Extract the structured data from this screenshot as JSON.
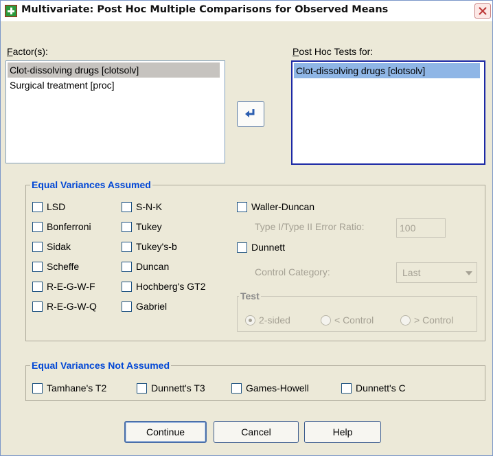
{
  "window": {
    "title": "Multivariate: Post Hoc Multiple Comparisons for Observed Means"
  },
  "factors": {
    "label": "Factor(s):",
    "items": [
      "Clot-dissolving drugs [clotsolv]",
      "Surgical treatment [proc]"
    ]
  },
  "posthoc": {
    "label": "Post Hoc Tests for:",
    "items": [
      "Clot-dissolving drugs [clotsolv]"
    ]
  },
  "move_button": {
    "icon": "arrow-left-icon"
  },
  "equal_variances": {
    "title": "Equal Variances Assumed",
    "col1": [
      "LSD",
      "Bonferroni",
      "Sidak",
      "Scheffe",
      "R-E-G-W-F",
      "R-E-G-W-Q"
    ],
    "col2": [
      "S-N-K",
      "Tukey",
      "Tukey's-b",
      "Duncan",
      "Hochberg's GT2",
      "Gabriel"
    ],
    "waller_duncan": "Waller-Duncan",
    "error_ratio_label": "Type I/Type II Error Ratio:",
    "error_ratio_value": "100",
    "dunnett": "Dunnett",
    "control_category_label": "Control Category:",
    "control_category_value": "Last",
    "test": {
      "title": "Test",
      "options": [
        "2-sided",
        "< Control",
        "> Control"
      ],
      "selected": "2-sided"
    }
  },
  "unequal_variances": {
    "title": "Equal Variances Not Assumed",
    "items": [
      "Tamhane's T2",
      "Dunnett's T3",
      "Games-Howell",
      "Dunnett's C"
    ]
  },
  "buttons": {
    "continue": "Continue",
    "cancel": "Cancel",
    "help": "Help"
  },
  "colors": {
    "group_title": "#0046d5",
    "selection_blue": "#8fb6e6",
    "dialog_bg": "#ece9d8"
  }
}
